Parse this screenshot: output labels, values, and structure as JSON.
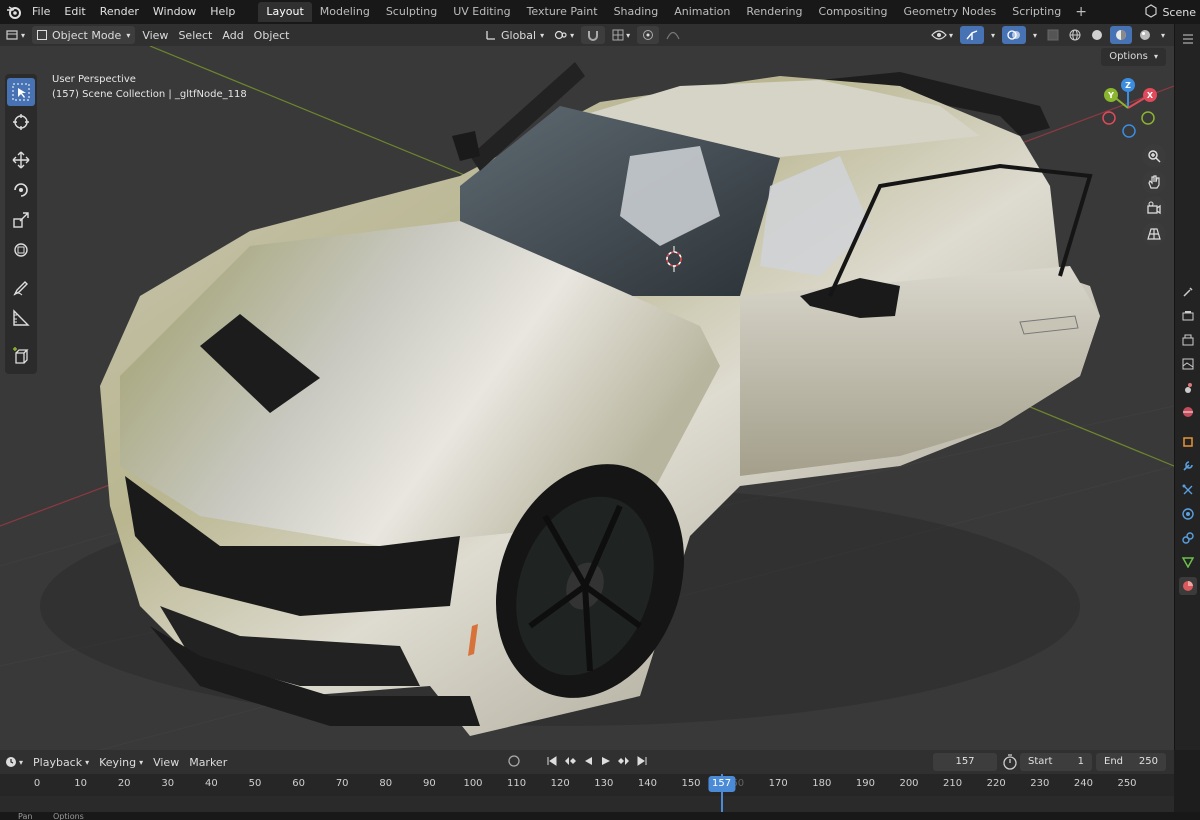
{
  "menu": [
    "File",
    "Edit",
    "Render",
    "Window",
    "Help"
  ],
  "workspaces": [
    "Layout",
    "Modeling",
    "Sculpting",
    "UV Editing",
    "Texture Paint",
    "Shading",
    "Animation",
    "Rendering",
    "Compositing",
    "Geometry Nodes",
    "Scripting"
  ],
  "active_workspace": "Layout",
  "workspace_add": "+",
  "scene_name": "Scene",
  "header": {
    "mode": "Object Mode",
    "view": "View",
    "select": "Select",
    "add": "Add",
    "object": "Object",
    "transform_orientation": "Global",
    "options": "Options"
  },
  "viewport": {
    "perspective": "User Perspective",
    "collection": "(157) Scene Collection | _gltfNode_118"
  },
  "gizmo": {
    "x": "X",
    "y": "Y",
    "z": "Z"
  },
  "timeline": {
    "playback": "Playback",
    "keying": "Keying",
    "view": "View",
    "marker": "Marker",
    "current_frame": "157",
    "start_label": "Start",
    "start": "1",
    "end_label": "End",
    "end": "250",
    "ticks": [
      "0",
      "10",
      "20",
      "30",
      "40",
      "50",
      "60",
      "70",
      "80",
      "90",
      "100",
      "110",
      "120",
      "130",
      "140",
      "150",
      "160",
      "170",
      "180",
      "190",
      "200",
      "210",
      "220",
      "230",
      "240",
      "250"
    ]
  },
  "status": {
    "pan": "Pan",
    "options": "Options"
  },
  "colors": {
    "accent": "#4772b3",
    "axis_x": "#e04a5a",
    "axis_y": "#8ab52e",
    "axis_z": "#3b8de0"
  }
}
